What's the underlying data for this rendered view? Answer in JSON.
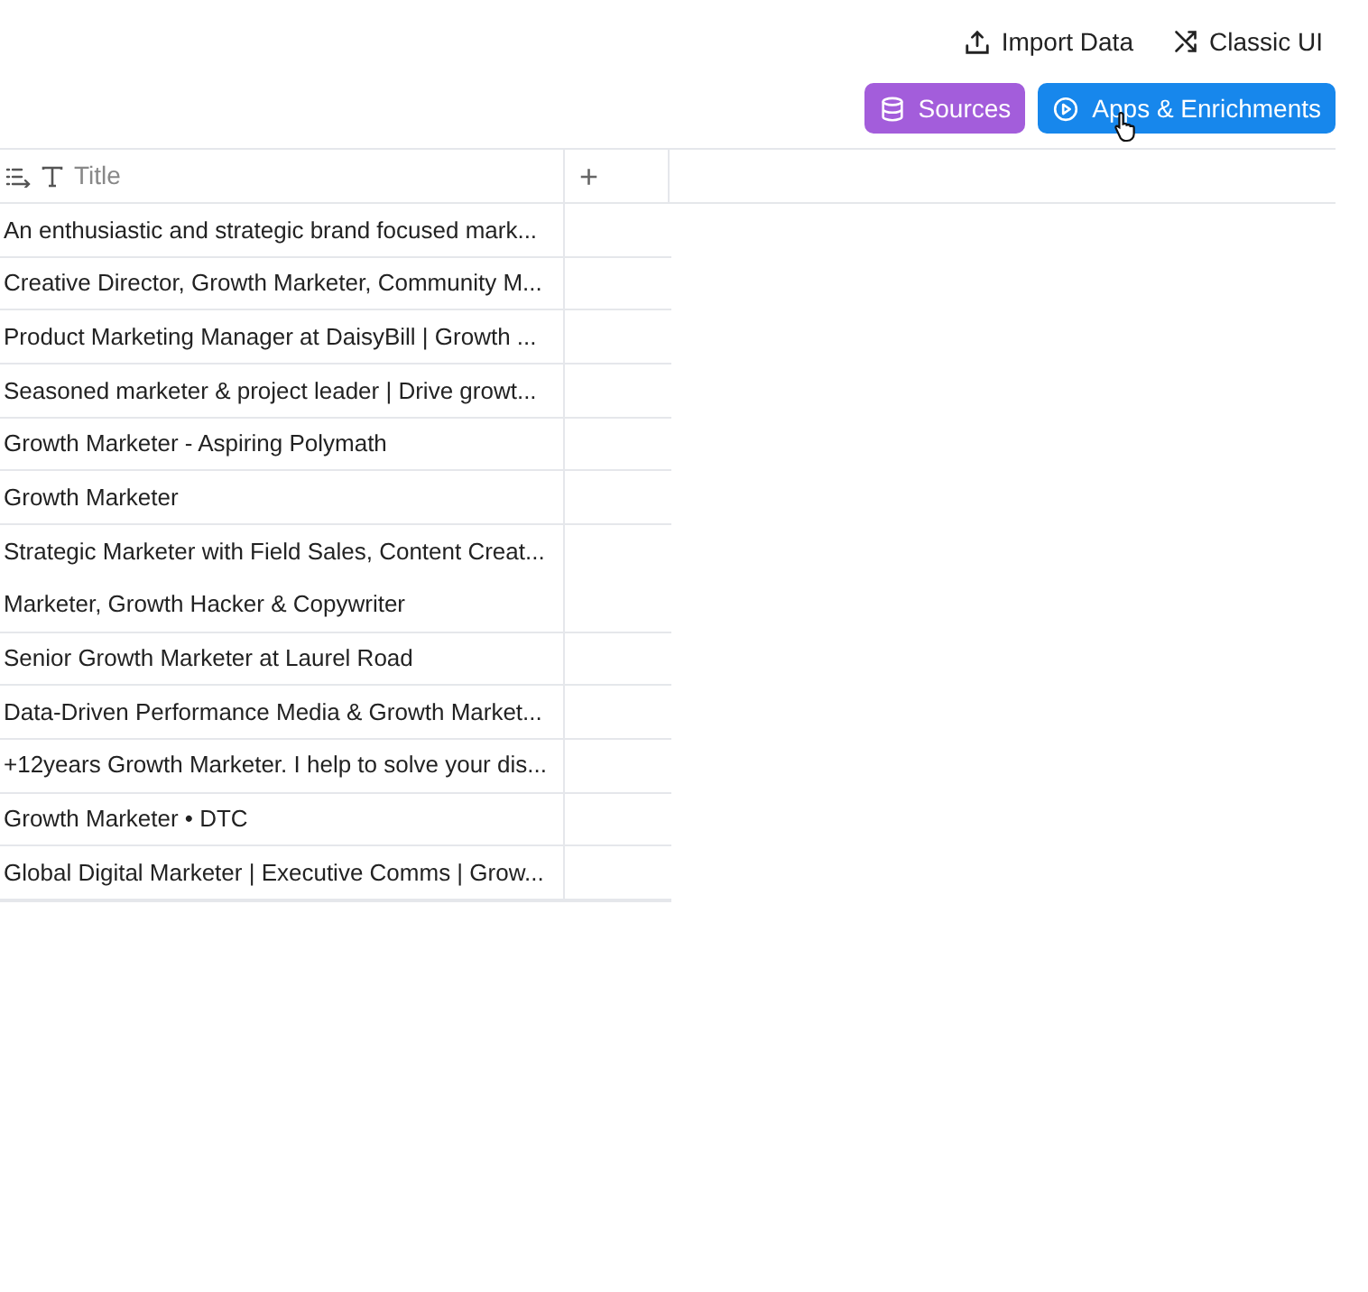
{
  "top_actions": [
    {
      "kind": "import",
      "label": "Import Data"
    },
    {
      "kind": "shuffle",
      "label": "Classic UI"
    }
  ],
  "buttons": [
    {
      "kind": "database",
      "label": "Sources",
      "color": "#a35ddb"
    },
    {
      "kind": "play",
      "label": "Apps & Enrichments",
      "color": "#1787ec"
    }
  ],
  "table": {
    "columns": [
      {
        "kind": "text",
        "label": "Title"
      },
      {
        "kind": "add",
        "label": "+"
      }
    ],
    "rows": [
      {
        "title": "An enthusiastic and strategic brand focused mark...",
        "divider": true
      },
      {
        "title": "Creative Director, Growth Marketer, Community M...",
        "divider": true
      },
      {
        "title": "Product Marketing Manager at DaisyBill | Growth ...",
        "divider": true
      },
      {
        "title": "Seasoned marketer & project leader | Drive growt...",
        "divider": true
      },
      {
        "title": "Growth Marketer - Aspiring Polymath",
        "divider": true
      },
      {
        "title": "Growth Marketer",
        "divider": true
      },
      {
        "title": "Strategic Marketer with Field Sales, Content Creat...",
        "divider": false
      },
      {
        "title": "Marketer, Growth Hacker & Copywriter",
        "divider": true
      },
      {
        "title": "Senior Growth Marketer at Laurel Road",
        "divider": true
      },
      {
        "title": "Data-Driven Performance Media & Growth Market...",
        "divider": true
      },
      {
        "title": "+12years Growth Marketer. I help to solve your dis...",
        "divider": true
      },
      {
        "title": "Growth Marketer • DTC",
        "divider": true
      },
      {
        "title": "Global Digital Marketer | Executive Comms | Grow...",
        "divider": true
      }
    ]
  }
}
